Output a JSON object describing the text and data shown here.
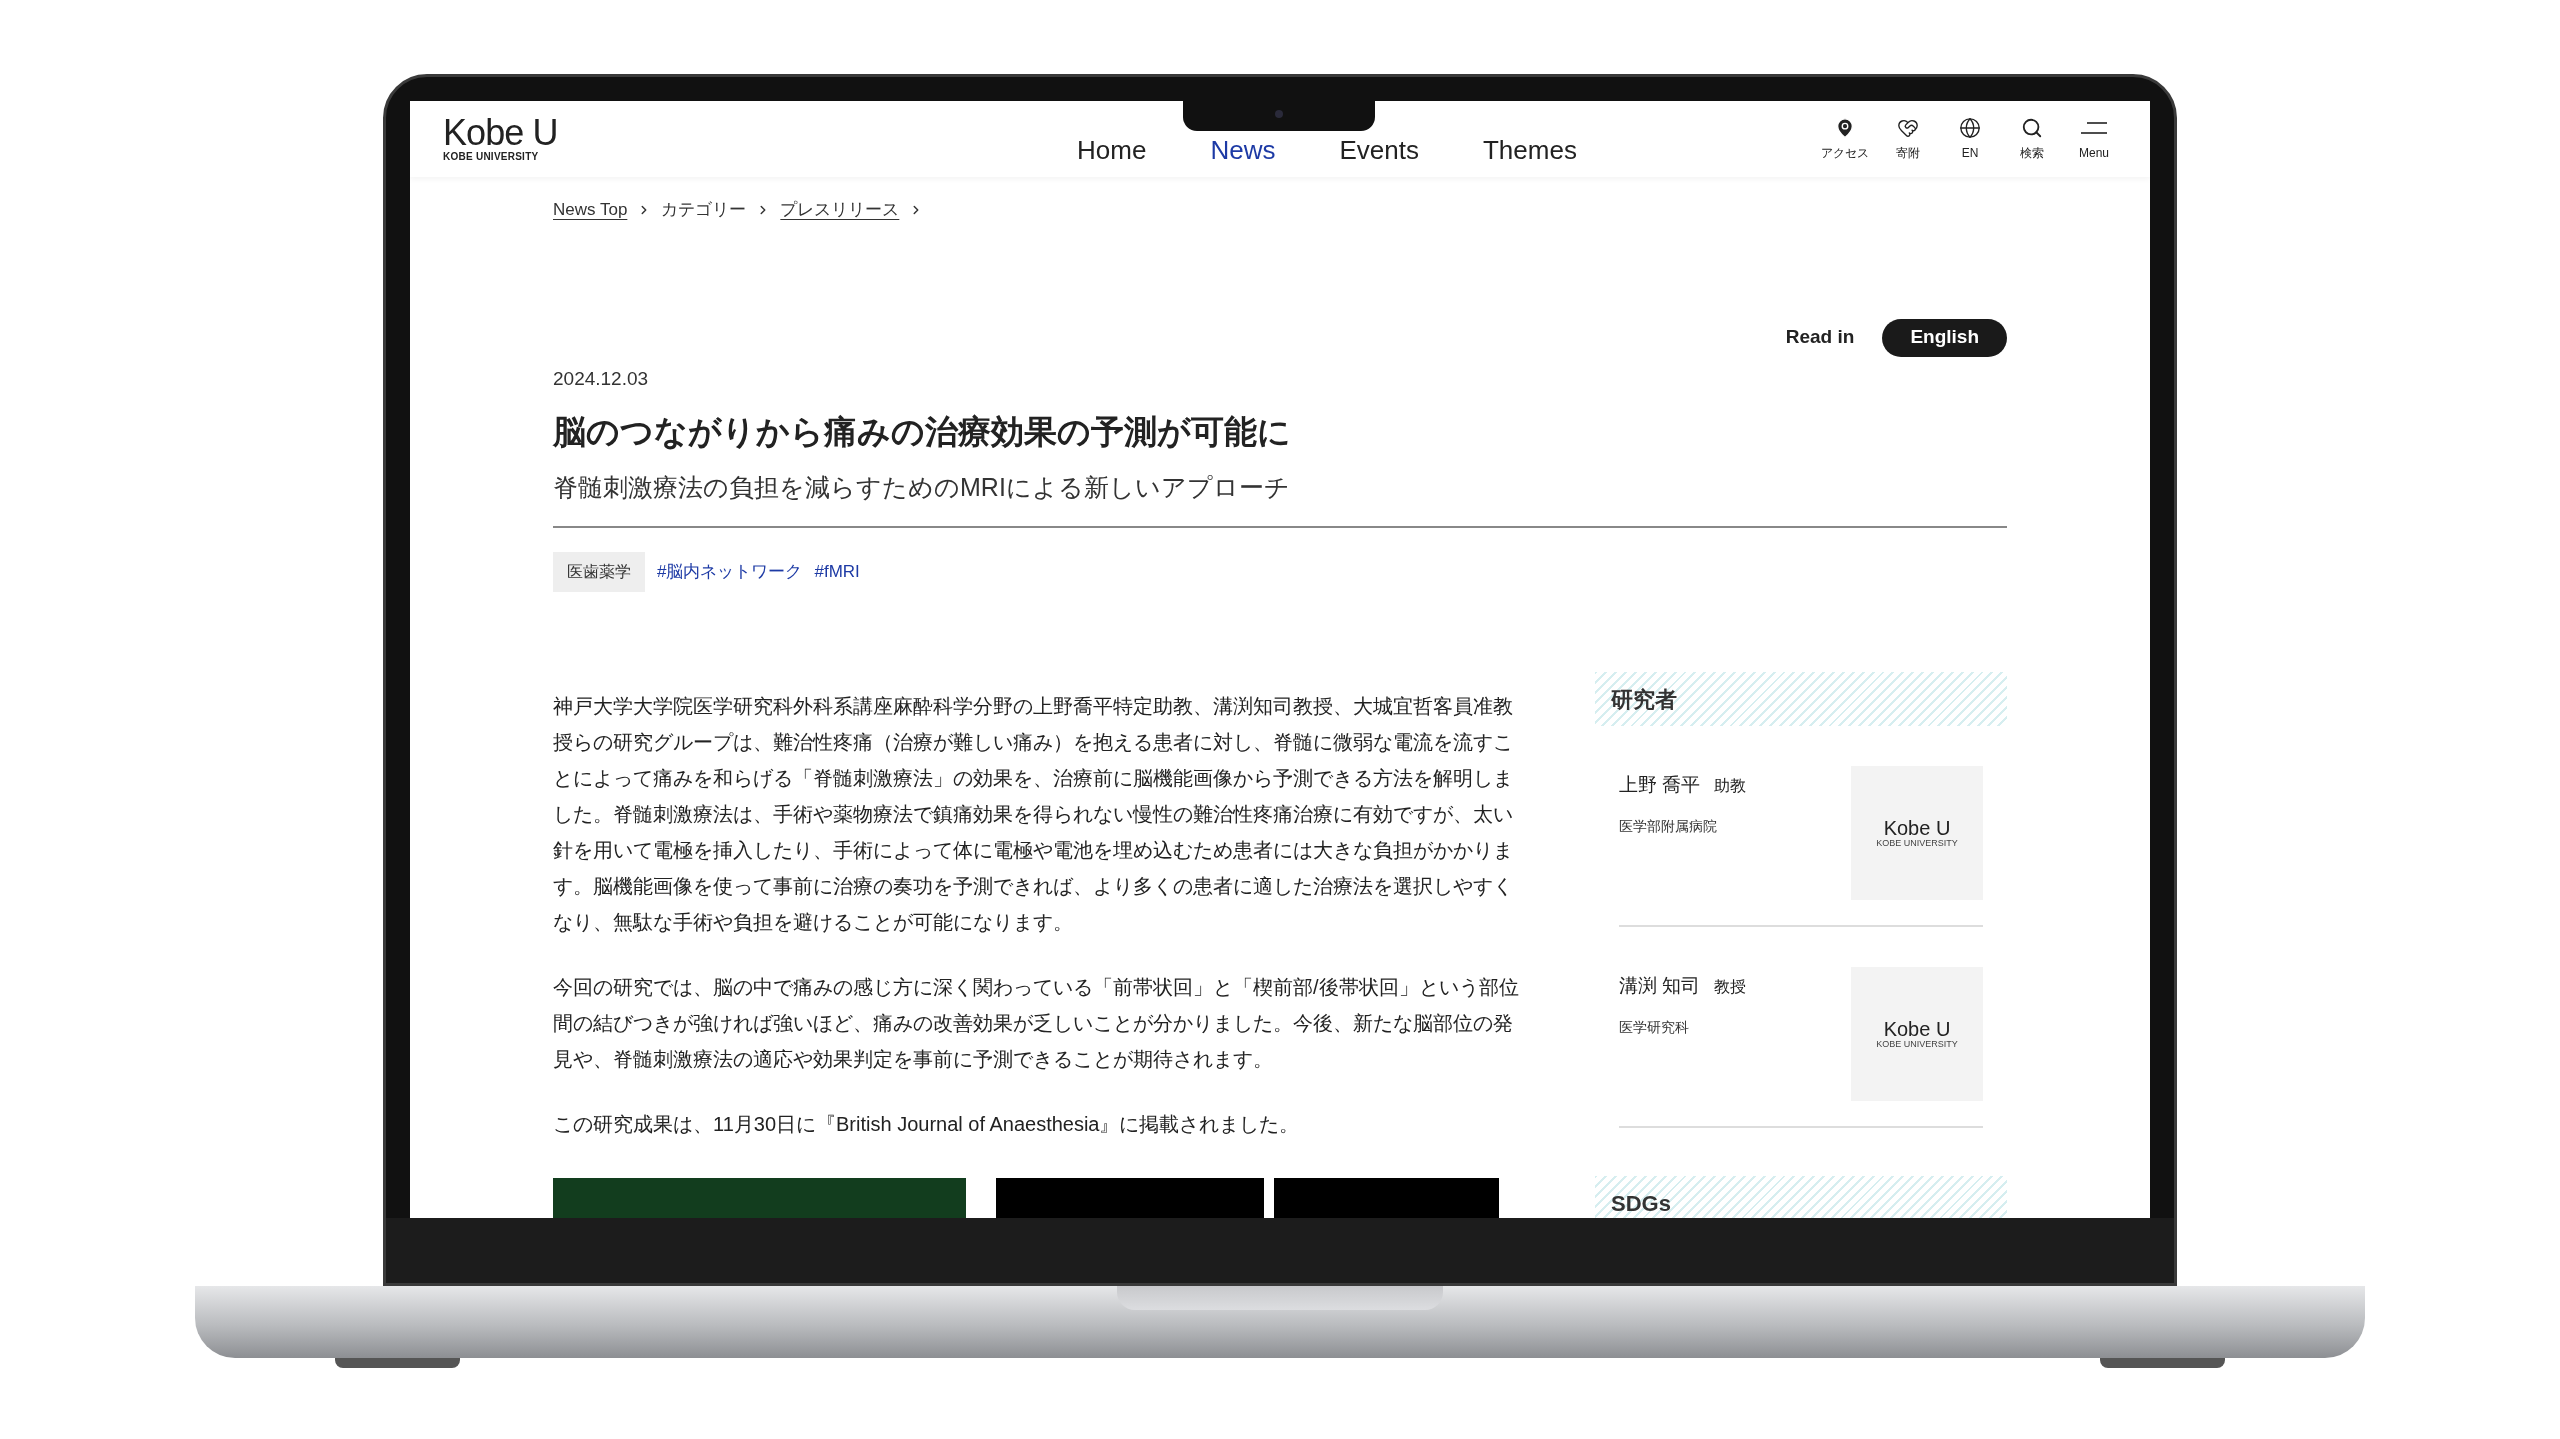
{
  "header": {
    "logo": "Kobe U",
    "logo_sub": "KOBE UNIVERSITY",
    "nav": [
      {
        "label": "Home",
        "selected": false
      },
      {
        "label": "News",
        "selected": true
      },
      {
        "label": "Events",
        "selected": false
      },
      {
        "label": "Themes",
        "selected": false
      }
    ],
    "utilities": [
      {
        "kind": "pin",
        "label": "アクセス"
      },
      {
        "kind": "heart",
        "label": "寄附"
      },
      {
        "kind": "globe",
        "label": "EN"
      },
      {
        "kind": "search",
        "label": "検索"
      },
      {
        "kind": "menu",
        "label": "Menu"
      }
    ]
  },
  "breadcrumb": [
    {
      "label": "News Top",
      "link": true
    },
    {
      "label": "カテゴリー",
      "link": false
    },
    {
      "label": "プレスリリース",
      "link": true
    }
  ],
  "read_in": {
    "label": "Read in",
    "button": "English"
  },
  "article": {
    "date": "2024.12.03",
    "title": "脳のつながりから痛みの治療効果の予測が可能に",
    "subtitle": "脊髄刺激療法の負担を減らすためのMRIによる新しいアプローチ",
    "category": "医歯薬学",
    "tags": [
      "#脳内ネットワーク",
      "#fMRI"
    ],
    "paragraphs": [
      "神戸大学大学院医学研究科外科系講座麻酔科学分野の上野喬平特定助教、溝渕知司教授、大城宜哲客員准教授らの研究グループは、難治性疼痛（治療が難しい痛み）を抱える患者に対し、脊髄に微弱な電流を流すことによって痛みを和らげる「脊髄刺激療法」の効果を、治療前に脳機能画像から予測できる方法を解明しました。脊髄刺激療法は、手術や薬物療法で鎮痛効果を得られない慢性の難治性疼痛治療に有効ですが、太い針を用いて電極を挿入したり、手術によって体に電極や電池を埋め込むため患者には大きな負担がかかります。脳機能画像を使って事前に治療の奏功を予測できれば、より多くの患者に適した治療法を選択しやすくなり、無駄な手術や負担を避けることが可能になります。",
      "今回の研究では、脳の中で痛みの感じ方に深く関わっている「前帯状回」と「楔前部/後帯状回」という部位間の結びつきが強ければ強いほど、痛みの改善効果が乏しいことが分かりました。今後、新たな脳部位の発見や、脊髄刺激療法の適応や効果判定を事前に予測できることが期待されます。",
      "この研究成果は、11月30日に『British Journal of Anaesthesia』に掲載されました。"
    ]
  },
  "sidebar": {
    "researchers_heading": "研究者",
    "researchers": [
      {
        "name": "上野 喬平",
        "role": "助教",
        "affiliation": "医学部附属病院",
        "logo": "Kobe U",
        "logo_sub": "KOBE UNIVERSITY"
      },
      {
        "name": "溝渕 知司",
        "role": "教授",
        "affiliation": "医学研究科",
        "logo": "Kobe U",
        "logo_sub": "KOBE UNIVERSITY"
      }
    ],
    "sdgs_heading": "SDGs"
  }
}
